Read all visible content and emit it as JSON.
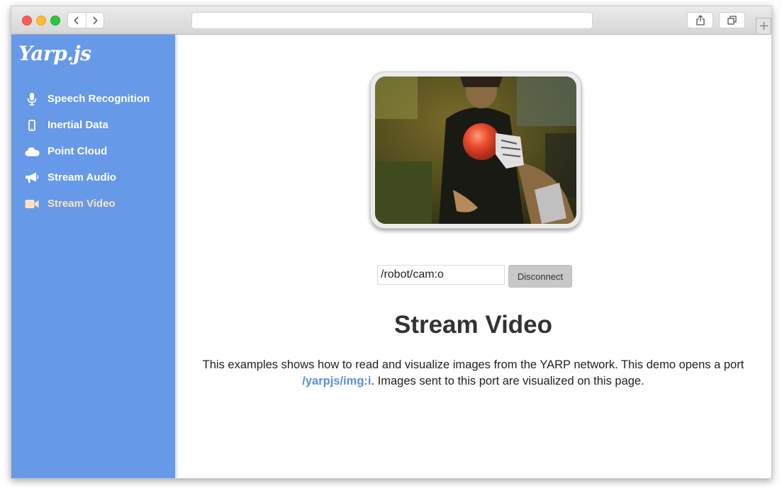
{
  "browser": {
    "url": ""
  },
  "sidebar": {
    "logo": "Yarp.js",
    "items": [
      {
        "label": "Speech Recognition",
        "icon": "microphone-icon"
      },
      {
        "label": "Inertial Data",
        "icon": "mobile-phone-icon"
      },
      {
        "label": "Point Cloud",
        "icon": "cloud-icon"
      },
      {
        "label": "Stream Audio",
        "icon": "megaphone-icon"
      },
      {
        "label": "Stream Video",
        "icon": "video-camera-icon",
        "active": true
      }
    ],
    "bg_color": "#6699e8",
    "active_color": "#fde3c2"
  },
  "main": {
    "port_input": "/robot/cam:o",
    "disconnect_label": "Disconnect",
    "title": "Stream Video",
    "desc_before": "This examples shows how to read and visualize images from the YARP network. This demo opens a port ",
    "desc_link": "/yarpjs/img:i",
    "desc_after": ". Images sent to this port are visualized on this page.",
    "link_color": "#5b8fde"
  }
}
